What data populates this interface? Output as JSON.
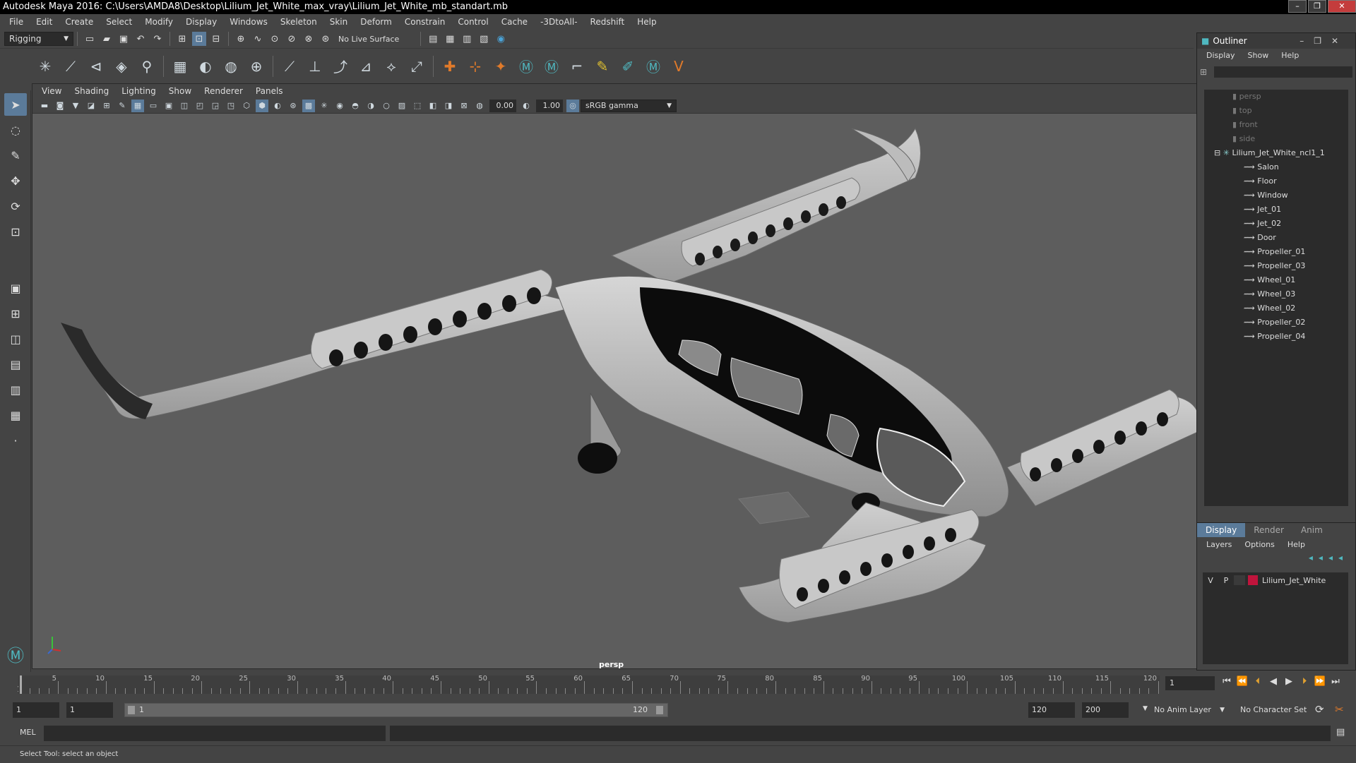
{
  "window": {
    "title": "Autodesk Maya 2016: C:\\Users\\AMDA8\\Desktop\\Lilium_Jet_White_max_vray\\Lilium_Jet_White_mb_standart.mb"
  },
  "menubar": [
    "File",
    "Edit",
    "Create",
    "Select",
    "Modify",
    "Display",
    "Windows",
    "Skeleton",
    "Skin",
    "Deform",
    "Constrain",
    "Control",
    "Cache",
    "-3DtoAll-",
    "Redshift",
    "Help"
  ],
  "statusline": {
    "mode": "Rigging",
    "live_surface": "No Live Surface"
  },
  "viewport": {
    "menu": [
      "View",
      "Shading",
      "Lighting",
      "Show",
      "Renderer",
      "Panels"
    ],
    "near_value": "0.00",
    "far_value": "1.00",
    "color_space": "sRGB gamma",
    "camera_label": "persp",
    "colors": {
      "background": "#5d5d5d",
      "body": "#bdbdbd",
      "canopy": "#0c0c0c"
    }
  },
  "outliner": {
    "title": "Outliner",
    "menu": [
      "Display",
      "Show",
      "Help"
    ],
    "cameras": [
      "persp",
      "top",
      "front",
      "side"
    ],
    "root": "Lilium_Jet_White_ncl1_1",
    "children": [
      "Salon",
      "Floor",
      "Window",
      "Jet_01",
      "Jet_02",
      "Door",
      "Propeller_01",
      "Propeller_03",
      "Wheel_01",
      "Wheel_03",
      "Wheel_02",
      "Propeller_02",
      "Propeller_04"
    ]
  },
  "channelbox": {
    "tabs": [
      "Display",
      "Render",
      "Anim"
    ],
    "menu": [
      "Layers",
      "Options",
      "Help"
    ],
    "layer": {
      "v": "V",
      "p": "P",
      "name": "Lilium_Jet_White",
      "color": "#c0143c"
    }
  },
  "timeline": {
    "ticks": [
      "5",
      "10",
      "15",
      "20",
      "25",
      "30",
      "35",
      "40",
      "45",
      "50",
      "55",
      "60",
      "65",
      "70",
      "75",
      "80",
      "85",
      "90",
      "95",
      "100",
      "105",
      "110",
      "115",
      "120"
    ],
    "start_marker": "1",
    "current_frame": "1"
  },
  "range": {
    "start_time": "1",
    "playback_start": "1",
    "slider_start": "1",
    "slider_end": "120",
    "playback_end": "120",
    "end_time": "200",
    "anim_layer": "No Anim Layer",
    "character_set": "No Character Set"
  },
  "cmdline": {
    "label": "MEL"
  },
  "helpline": {
    "text": "Select Tool: select an object"
  }
}
